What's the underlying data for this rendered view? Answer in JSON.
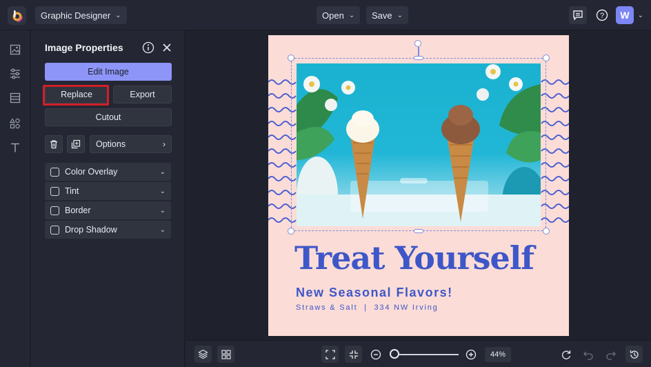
{
  "app": {
    "mode_label": "Graphic Designer",
    "user_initial": "W"
  },
  "toolbar": {
    "open_label": "Open",
    "save_label": "Save"
  },
  "panel": {
    "title": "Image Properties",
    "edit_image_label": "Edit Image",
    "replace_label": "Replace",
    "export_label": "Export",
    "cutout_label": "Cutout",
    "options_label": "Options",
    "adjustments": [
      {
        "label": "Color Overlay",
        "checked": false
      },
      {
        "label": "Tint",
        "checked": false
      },
      {
        "label": "Border",
        "checked": false
      },
      {
        "label": "Drop Shadow",
        "checked": false
      }
    ]
  },
  "canvas": {
    "headline": "Treat Yourself",
    "subhead": "New Seasonal Flavors!",
    "address": "Straws & Salt  |  334 NW Irving",
    "background_color": "#fbdcd7",
    "text_color": "#3e57c8"
  },
  "bottom": {
    "zoom_label": "44%"
  },
  "icons": {
    "rail": [
      "image-icon",
      "sliders-icon",
      "layout-icon",
      "elements-icon",
      "text-icon"
    ],
    "top_right": [
      "feedback-icon",
      "help-icon"
    ]
  },
  "colors": {
    "accent": "#8d95f8",
    "highlight": "#d21f27",
    "bg": "#1f222c",
    "panel": "#242733"
  }
}
